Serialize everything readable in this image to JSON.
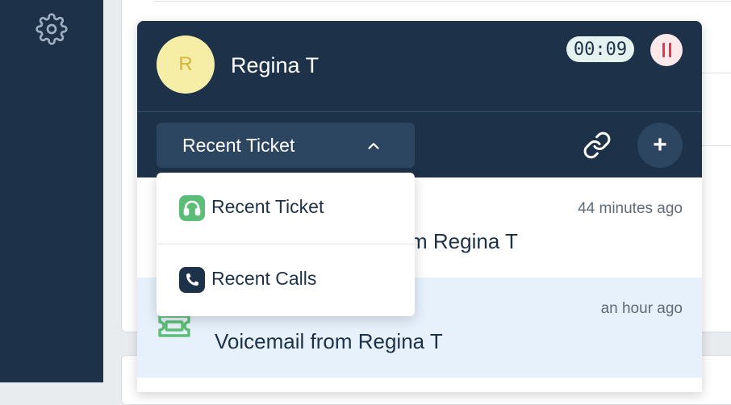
{
  "sidebar": {
    "settings_icon": "gear-icon"
  },
  "caller": {
    "avatar_initial": "R",
    "name": "Regina T",
    "timer": "00:09"
  },
  "toolbar": {
    "dropdown_selected": "Recent Ticket",
    "link_icon": "link-icon",
    "add_label": "+"
  },
  "dropdown_menu": {
    "items": [
      {
        "label": "Recent Ticket",
        "icon": "headset-icon",
        "icon_color": "#5cbd76"
      },
      {
        "label": "Recent Calls",
        "icon": "phone-icon",
        "icon_color": "#1d3249"
      }
    ]
  },
  "list": {
    "items": [
      {
        "time": "44 minutes ago",
        "title_visible": "m Regina T"
      },
      {
        "time": "an hour ago",
        "title": "Voicemail from Regina T",
        "icon": "ticket-icon"
      }
    ]
  },
  "colors": {
    "navy": "#1d3249",
    "accent_green": "#5cbd76",
    "pause_red": "#e0384c",
    "highlight_row": "#e7f1fb"
  }
}
